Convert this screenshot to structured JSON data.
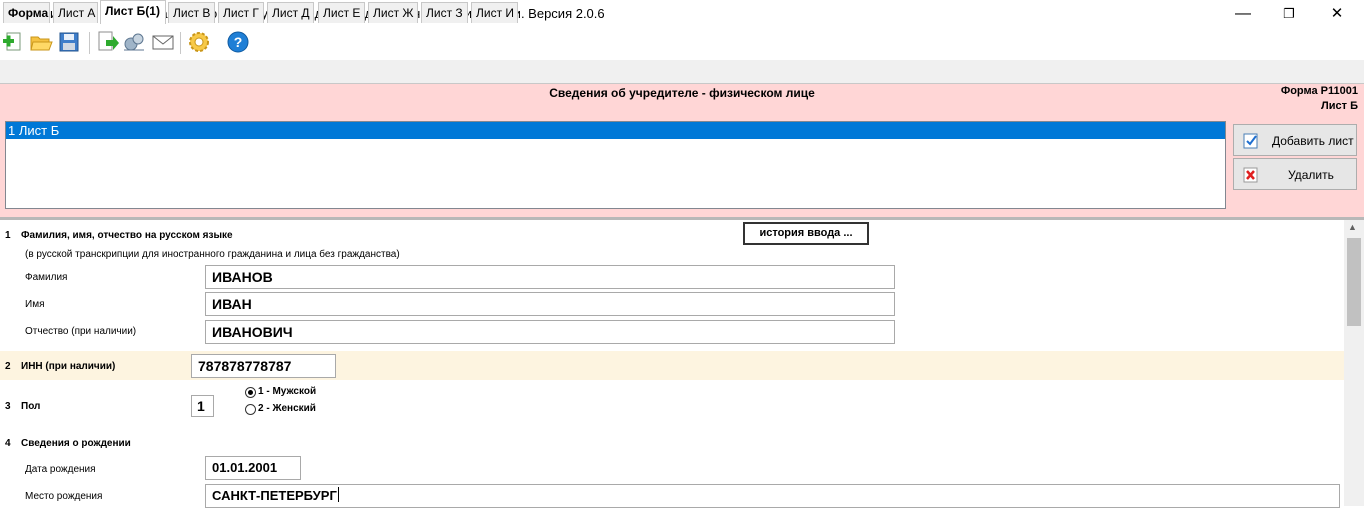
{
  "window": {
    "title": "Без имени - Программа подготовки документов для государственной регистрации. Версия 2.0.6",
    "minimize": "—",
    "maximize": "❐",
    "close": "✕"
  },
  "toolbar": {
    "icons": [
      "new-document-icon",
      "open-folder-icon",
      "save-icon",
      "export-icon",
      "send-icon",
      "mail-icon",
      "settings-icon",
      "help-icon"
    ]
  },
  "tabs": [
    "Форма",
    "Лист А",
    "Лист Б(1)",
    "Лист В",
    "Лист Г",
    "Лист Д",
    "Лист Е",
    "Лист Ж",
    "Лист З",
    "Лист И"
  ],
  "active_tab": "Лист Б(1)",
  "header": {
    "title": "Сведения об учредителе - физическом лице",
    "form_code": "Форма Р11001",
    "sheet": "Лист Б"
  },
  "sheets_list": {
    "items": [
      "1 Лист Б"
    ],
    "add_button": "Добавить лист",
    "delete_button": "Удалить"
  },
  "form": {
    "history_button": "история ввода ...",
    "s1": {
      "num": "1",
      "title": "Фамилия, имя, отчество на русском языке",
      "note": "(в русской транскрипции для иностранного гражданина и лица без гражданства)",
      "surname_label": "Фамилия",
      "surname_value": "ИВАНОВ",
      "name_label": "Имя",
      "name_value": "ИВАН",
      "patronymic_label": "Отчество (при наличии)",
      "patronymic_value": "ИВАНОВИЧ"
    },
    "s2": {
      "num": "2",
      "title": "ИНН (при наличии)",
      "value": "787878778787"
    },
    "s3": {
      "num": "3",
      "title": "Пол",
      "value": "1",
      "option1": "1 - Мужской",
      "option2": "2 - Женский",
      "selected": "1"
    },
    "s4": {
      "num": "4",
      "title": "Сведения о рождении",
      "birth_date_label": "Дата рождения",
      "birth_date_value": "01.01.2001",
      "birth_place_label": "Место рождения",
      "birth_place_value": "САНКТ-ПЕТЕРБУРГ"
    }
  },
  "colors": {
    "panel_pink": "#ffd6d6",
    "selection": "#0078d7",
    "inn_band": "#fdf4e0"
  }
}
